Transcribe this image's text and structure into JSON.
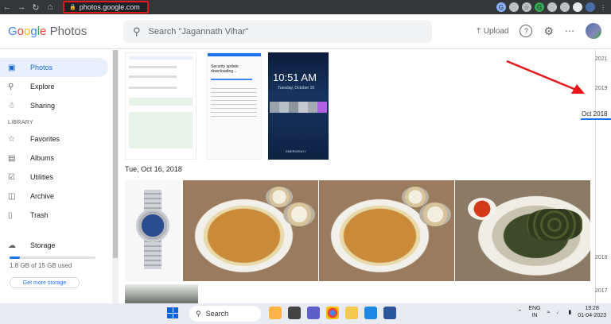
{
  "browser": {
    "url": "photos.google.com",
    "nav_icons": [
      "back-icon",
      "forward-icon",
      "reload-icon",
      "home-icon"
    ]
  },
  "header": {
    "logo_google": "Google",
    "logo_photos": "Photos",
    "search_placeholder": "Search \"Jagannath Vihar\"",
    "upload_label": "Upload"
  },
  "sidebar": {
    "items_top": [
      {
        "label": "Photos",
        "icon": "photos-icon",
        "active": true
      },
      {
        "label": "Explore",
        "icon": "search-icon"
      },
      {
        "label": "Sharing",
        "icon": "people-icon"
      }
    ],
    "library_label": "LIBRARY",
    "library_items": [
      {
        "label": "Favorites",
        "icon": "star-icon"
      },
      {
        "label": "Albums",
        "icon": "album-icon"
      },
      {
        "label": "Utilities",
        "icon": "utilities-icon"
      },
      {
        "label": "Archive",
        "icon": "archive-icon"
      },
      {
        "label": "Trash",
        "icon": "trash-icon"
      }
    ],
    "storage_label": "Storage",
    "storage_used_text": "1.8 GB of 15 GB used",
    "storage_fraction": 0.12,
    "get_storage_label": "Get more storage"
  },
  "content": {
    "date_heading": "Tue, Oct 16, 2018",
    "screenshot2_title": "Security update downloading...",
    "lock_time": "10:51 AM",
    "lock_date": "Tuesday, October 16",
    "lock_emergency": "EMERGENCY"
  },
  "timeline": {
    "years": [
      "2021",
      "2019",
      "2018",
      "2017"
    ],
    "current": "Oct 2018"
  },
  "taskbar": {
    "search_label": "Search",
    "lang": "ENG",
    "region": "IN",
    "time": "19:28",
    "date": "01-04-2023"
  },
  "colors": {
    "annotation_red": "#e3161a",
    "accent_blue": "#1a73e8"
  }
}
